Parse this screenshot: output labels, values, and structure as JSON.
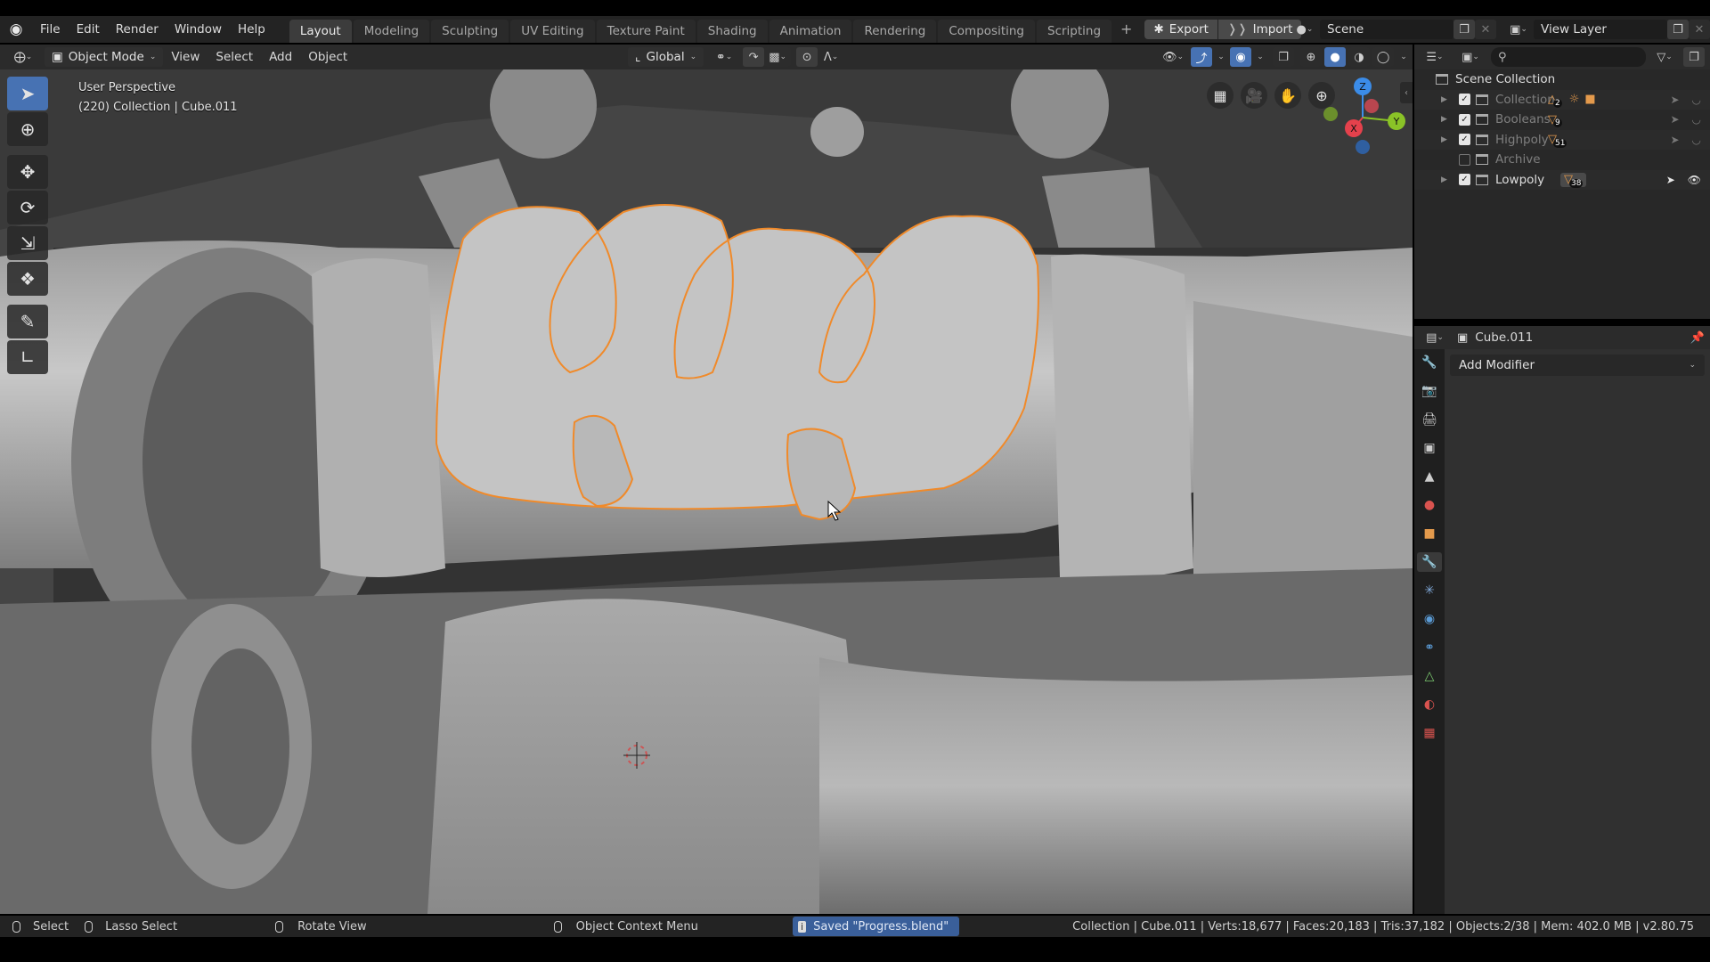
{
  "app": {
    "name": "Blender"
  },
  "menu": [
    "File",
    "Edit",
    "Render",
    "Window",
    "Help"
  ],
  "workspaces": [
    {
      "label": "Layout",
      "active": true
    },
    {
      "label": "Modeling"
    },
    {
      "label": "Sculpting"
    },
    {
      "label": "UV Editing"
    },
    {
      "label": "Texture Paint"
    },
    {
      "label": "Shading"
    },
    {
      "label": "Animation"
    },
    {
      "label": "Rendering"
    },
    {
      "label": "Compositing"
    },
    {
      "label": "Scripting"
    }
  ],
  "addon_buttons": {
    "export": "Export",
    "import": "Import",
    "add_workspace": "+"
  },
  "scene": {
    "name": "Scene",
    "view_layer": "View Layer"
  },
  "viewport_header": {
    "mode": "Object Mode",
    "menus": [
      "View",
      "Select",
      "Add",
      "Object"
    ],
    "orientation": "Global"
  },
  "viewport": {
    "view_name": "User Perspective",
    "context": "(220) Collection | Cube.011",
    "gizmo_axes": {
      "x": "X",
      "y": "Y",
      "z": "Z"
    },
    "colors": {
      "x": "#e5414c",
      "y": "#8ac327",
      "z": "#3b8ce8",
      "selection": "#f08a2a",
      "active_tool": "#4772b3"
    }
  },
  "toolbar": [
    {
      "name": "select-box",
      "active": true
    },
    {
      "name": "cursor"
    },
    {
      "name": "move"
    },
    {
      "name": "rotate"
    },
    {
      "name": "scale"
    },
    {
      "name": "transform"
    },
    {
      "name": "annotate"
    },
    {
      "name": "measure"
    }
  ],
  "outliner": {
    "root": "Scene Collection",
    "items": [
      {
        "name": "Collection",
        "checked": true,
        "dim": true,
        "badges": [
          "2"
        ],
        "extra_icons": [
          "light",
          "camera"
        ]
      },
      {
        "name": "Booleans",
        "checked": true,
        "dim": true,
        "badges": [
          "9"
        ]
      },
      {
        "name": "Highpoly",
        "checked": true,
        "dim": true,
        "badges": [
          "51"
        ]
      },
      {
        "name": "Archive",
        "checked": false,
        "dim": true,
        "badges": []
      },
      {
        "name": "Lowpoly",
        "checked": true,
        "dim": false,
        "badges": [
          "38"
        ]
      }
    ],
    "search_placeholder": ""
  },
  "properties": {
    "object_name": "Cube.011",
    "add_modifier_label": "Add Modifier",
    "active_tab": "modifiers"
  },
  "statusbar": {
    "select": "Select",
    "lasso": "Lasso Select",
    "rotate": "Rotate View",
    "context_menu": "Object Context Menu",
    "message": "Saved \"Progress.blend\"",
    "stats": "Collection | Cube.011 | Verts:18,677 | Faces:20,183 | Tris:37,182 | Objects:2/38 | Mem: 402.0 MB | v2.80.75"
  }
}
